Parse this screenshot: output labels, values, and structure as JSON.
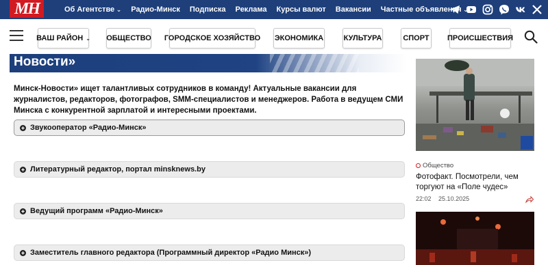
{
  "logo": "МН",
  "topnav": [
    {
      "label": "Об Агентстве",
      "dropdown": true
    },
    {
      "label": "Радио-Минск",
      "dropdown": false
    },
    {
      "label": "Подписка",
      "dropdown": false
    },
    {
      "label": "Реклама",
      "dropdown": false
    },
    {
      "label": "Курсы валют",
      "dropdown": false
    },
    {
      "label": "Вакансии",
      "dropdown": false
    },
    {
      "label": "Частные объявления",
      "dropdown": true
    }
  ],
  "social": [
    "telegram-icon",
    "youtube-icon",
    "instagram-icon",
    "viber-icon",
    "vk-icon",
    "x-icon"
  ],
  "categories": {
    "district": "ВАШ РАЙОН",
    "items": [
      "ОБЩЕСТВО",
      "ГОРОДСКОЕ ХОЗЯЙСТВО",
      "ЭКОНОМИКА",
      "КУЛЬТУРА",
      "СПОРТ",
      "ПРОИСШЕСТВИЯ"
    ]
  },
  "heading": "Новости»",
  "intro": "Минск-Новости» ищет талантливых сотрудников в команду! Актуальные вакансии для журналистов, редакторов, фотографов, SMM-специалистов и менеджеров. Работа в ведущем СМИ Минска с конкурентной зарплатой и интересными проектами.",
  "vacancies": [
    "Звукооператор «Радио-Минск»",
    "Литературный редактор, портал minsknews.by",
    "Ведущий программ «Радио-Минск»",
    "Заместитель главного редактора (Программный директор «Радио Минск»)"
  ],
  "sidebar": {
    "news": {
      "category": "Общество",
      "title": "Фотофакт. Посмотрели, чем торгуют на «Поле чудес»",
      "time": "22:02",
      "date": "25.10.2025"
    },
    "image_watermark": "М"
  },
  "colors": {
    "topbar": "#1e3f7a",
    "logo_red": "#d11a22",
    "banner_blue": "#1c3f7c",
    "accordion_bg": "#ececec"
  }
}
